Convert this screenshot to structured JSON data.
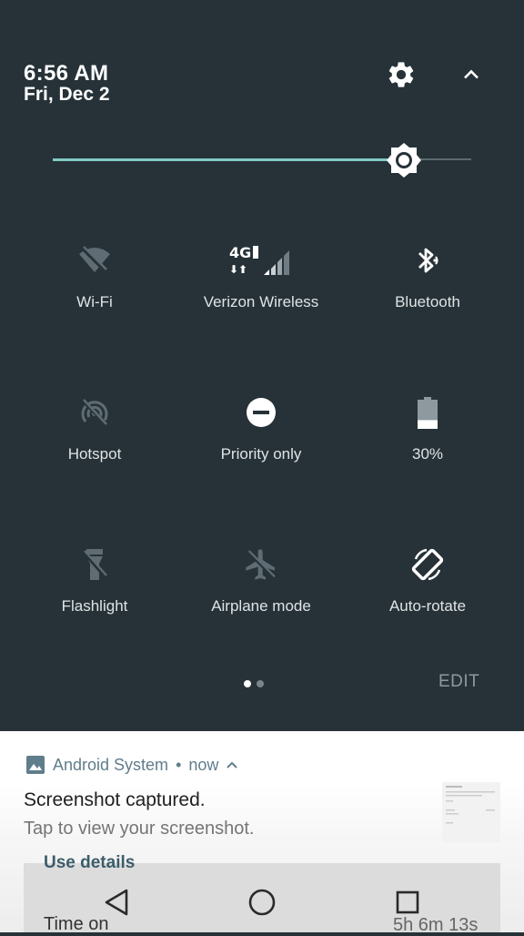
{
  "status": {
    "time": "6:56 AM",
    "date": "Fri, Dec 2"
  },
  "header": {
    "settings_icon": "gear-icon",
    "collapse_icon": "chevron-up-icon"
  },
  "brightness": {
    "level": 0.84,
    "accent_color": "#80cbc4"
  },
  "tiles": [
    {
      "label": "Wi-Fi",
      "icon": "wifi-off-icon"
    },
    {
      "label": "Verizon Wireless",
      "icon": "cellular-4g-lte-icon",
      "badge": "4G"
    },
    {
      "label": "Bluetooth",
      "icon": "bluetooth-icon"
    },
    {
      "label": "Hotspot",
      "icon": "hotspot-icon"
    },
    {
      "label": "Priority only",
      "icon": "do-not-disturb-icon"
    },
    {
      "label": "30%",
      "icon": "battery-icon",
      "battery_level": 0.3
    },
    {
      "label": "Flashlight",
      "icon": "flashlight-icon"
    },
    {
      "label": "Airplane mode",
      "icon": "airplane-icon"
    },
    {
      "label": "Auto-rotate",
      "icon": "auto-rotate-icon"
    }
  ],
  "pager": {
    "pages": 2,
    "current": 1
  },
  "edit_label": "EDIT",
  "notification": {
    "app_name": "Android System",
    "separator": "•",
    "time": "now",
    "title": "Screenshot captured.",
    "text": "Tap to view your screenshot.",
    "app_color": "#607d8b"
  },
  "background_content": {
    "heading": "Use details",
    "row_label": "Time on",
    "row_value": "5h 6m 13s"
  },
  "navbar": {
    "back_icon": "back-icon",
    "home_icon": "home-icon",
    "recents_icon": "recents-icon"
  }
}
